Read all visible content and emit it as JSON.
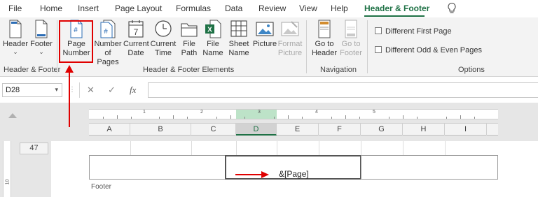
{
  "tabs": [
    {
      "label": "File",
      "active": false
    },
    {
      "label": "Home",
      "active": false
    },
    {
      "label": "Insert",
      "active": false
    },
    {
      "label": "Page Layout",
      "active": false
    },
    {
      "label": "Formulas",
      "active": false
    },
    {
      "label": "Data",
      "active": false
    },
    {
      "label": "Review",
      "active": false
    },
    {
      "label": "View",
      "active": false
    },
    {
      "label": "Help",
      "active": false
    },
    {
      "label": "Header & Footer",
      "active": true
    }
  ],
  "ribbon": {
    "header_footer_group": {
      "label": "Header & Footer",
      "header_label": "Header",
      "footer_label": "Footer"
    },
    "elements_group": {
      "label": "Header & Footer Elements",
      "page_number_line1": "Page",
      "page_number_line2": "Number",
      "number_of_pages_line1": "Number",
      "number_of_pages_line2": "of Pages",
      "current_date_line1": "Current",
      "current_date_line2": "Date",
      "current_time_line1": "Current",
      "current_time_line2": "Time",
      "file_path_line1": "File",
      "file_path_line2": "Path",
      "file_name_line1": "File",
      "file_name_line2": "Name",
      "sheet_name_line1": "Sheet",
      "sheet_name_line2": "Name",
      "picture_label": "Picture",
      "format_picture_line1": "Format",
      "format_picture_line2": "Picture",
      "date_icon_text": "7"
    },
    "navigation_group": {
      "label": "Navigation",
      "go_to_header_line1": "Go to",
      "go_to_header_line2": "Header",
      "go_to_footer_line1": "Go to",
      "go_to_footer_line2": "Footer"
    },
    "options_group": {
      "label": "Options",
      "different_first_page": "Different First Page",
      "different_odd_even": "Different Odd & Even Pages"
    }
  },
  "formula_bar": {
    "name_box": "D28",
    "cancel_symbol": "✕",
    "enter_symbol": "✓",
    "fx_symbol": "fx",
    "formula_value": ""
  },
  "sheet": {
    "columns": [
      "A",
      "B",
      "C",
      "D",
      "E",
      "F",
      "G",
      "H",
      "I"
    ],
    "selected_column": "D",
    "row_number": "47",
    "ruler_numbers": [
      "1",
      "2",
      "3",
      "4",
      "5"
    ],
    "vertical_ruler_number": "10",
    "footer_center_text": "&[Page]",
    "footer_label": "Footer"
  },
  "colors": {
    "accent_green": "#1e7145",
    "annotation_red": "#e00000",
    "selected_column_bg": "#d2d2d2"
  }
}
